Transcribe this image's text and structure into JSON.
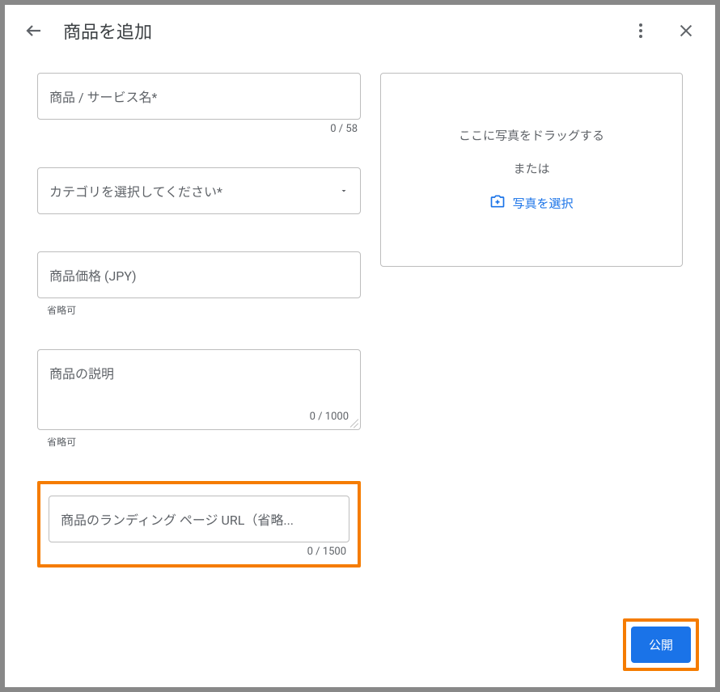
{
  "header": {
    "title": "商品を追加"
  },
  "fields": {
    "name": {
      "placeholder": "商品 / サービス名*",
      "counter": "0 / 58"
    },
    "category": {
      "placeholder": "カテゴリを選択してください*"
    },
    "price": {
      "placeholder": "商品価格 (JPY)",
      "helper": "省略可"
    },
    "description": {
      "placeholder": "商品の説明",
      "counter": "0 / 1000",
      "helper": "省略可"
    },
    "url": {
      "placeholder": "商品のランディング ページ URL（省略...",
      "counter": "0 / 1500"
    }
  },
  "dropzone": {
    "drag_text": "ここに写真をドラッグする",
    "or_text": "または",
    "select_text": "写真を選択"
  },
  "footer": {
    "publish_label": "公開"
  }
}
